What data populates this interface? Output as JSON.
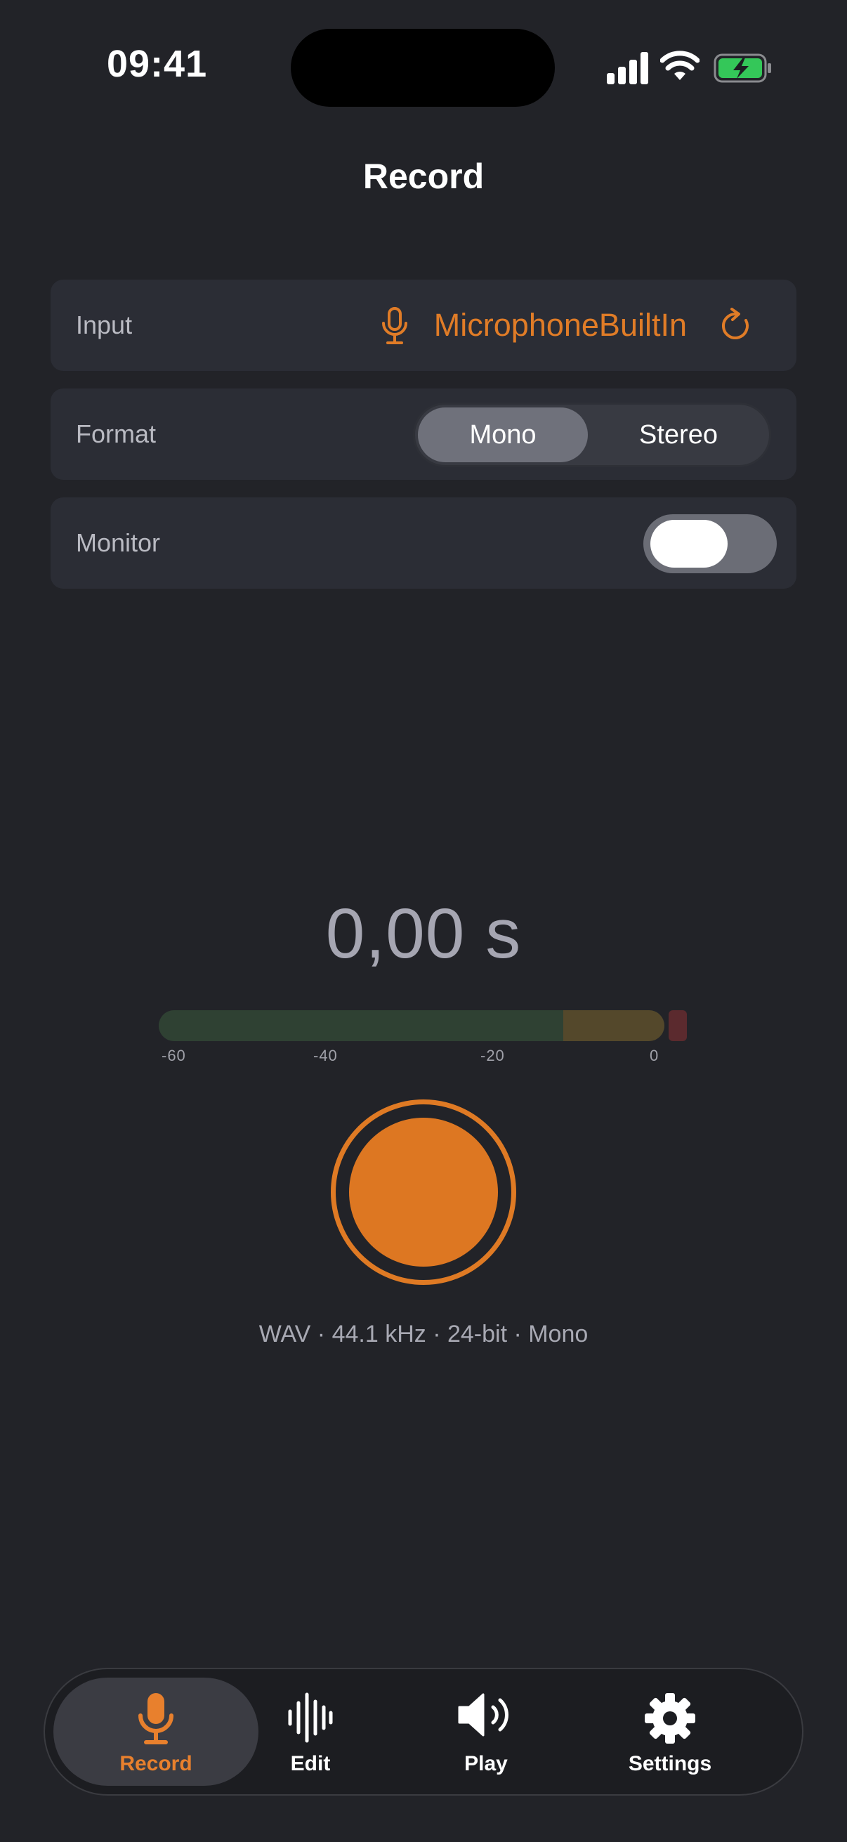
{
  "status": {
    "time": "09:41"
  },
  "header": {
    "title": "Record"
  },
  "input": {
    "label": "Input",
    "value": "MicrophoneBuiltIn"
  },
  "format": {
    "label": "Format",
    "options": [
      "Mono",
      "Stereo"
    ],
    "selected": "Mono"
  },
  "monitor": {
    "label": "Monitor",
    "enabled": false
  },
  "timer": {
    "value": "0,00 s"
  },
  "meter": {
    "ticks": [
      "-60",
      "-40",
      "-20",
      "0"
    ]
  },
  "recording_info": "WAV · 44.1 kHz · 24-bit · Mono",
  "tabs": [
    {
      "label": "Record",
      "icon": "microphone-icon",
      "active": true
    },
    {
      "label": "Edit",
      "icon": "waveform-icon",
      "active": false
    },
    {
      "label": "Play",
      "icon": "speaker-icon",
      "active": false
    },
    {
      "label": "Settings",
      "icon": "gear-icon",
      "active": false
    }
  ],
  "colors": {
    "accent": "#E07C27",
    "background": "#222328",
    "card": "#2B2D35"
  }
}
